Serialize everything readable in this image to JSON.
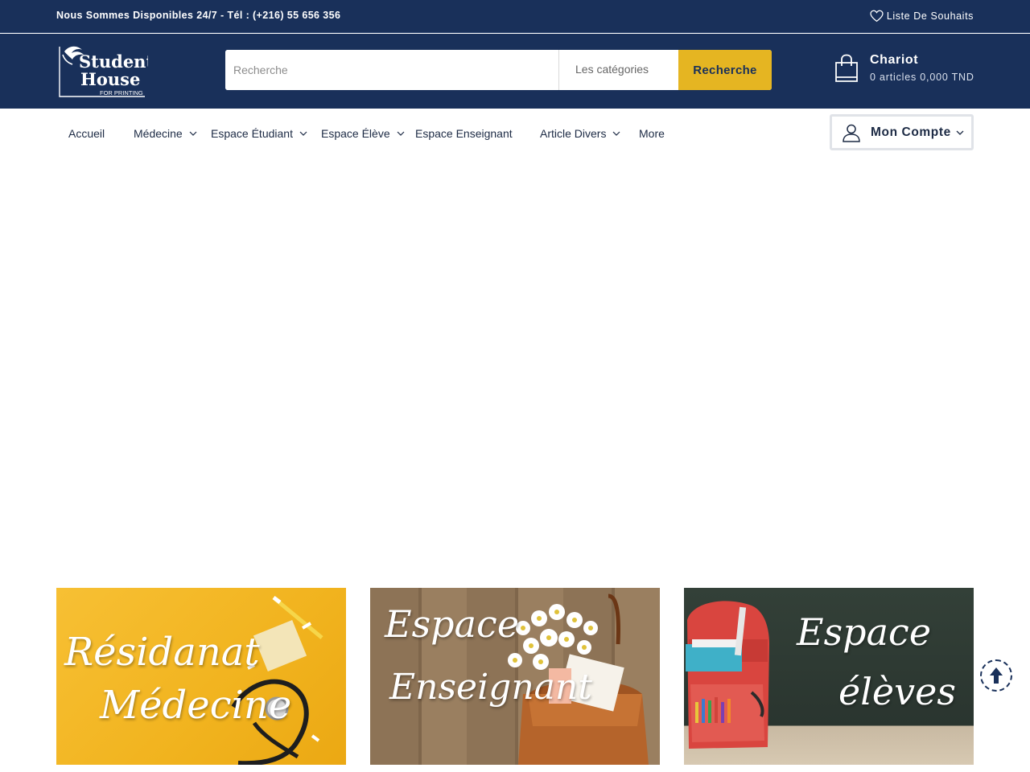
{
  "topbar": {
    "phone_text": "Nous Sommes Disponibles 24/7 - Tél : (+216) 55 656 356",
    "wishlist_label": "Liste De Souhaits"
  },
  "logo": {
    "line1": "Student",
    "line2": "House",
    "line3": "FOR PRINTING"
  },
  "search": {
    "placeholder": "Recherche",
    "value": "",
    "categories_label": "Les catégories",
    "button_label": "Recherche"
  },
  "cart": {
    "title": "Chariot",
    "summary": "0 articles 0,000 TND"
  },
  "nav": {
    "items": [
      {
        "label": "Accueil"
      },
      {
        "label": "Médecine"
      },
      {
        "label": "Espace Étudiant"
      },
      {
        "label": "Espace Élève"
      },
      {
        "label": "Espace Enseignant"
      },
      {
        "label": "Article Divers"
      },
      {
        "label": "More"
      }
    ],
    "account_label": "Mon Compte"
  },
  "banners": [
    {
      "line1": "Résidanat",
      "line2": "Médecine"
    },
    {
      "line1": "Espace",
      "line2": "Enseignant"
    },
    {
      "line1": "Espace",
      "line2": "élèves"
    }
  ],
  "icons": {
    "wishlist": "heart-icon",
    "cart": "shopping-bag-icon",
    "account": "user-icon",
    "dropdown": "chevron-down-icon",
    "scroll_top": "arrow-up-icon"
  },
  "colors": {
    "brand_navy": "#19305a",
    "accent_yellow": "#e5b522"
  }
}
